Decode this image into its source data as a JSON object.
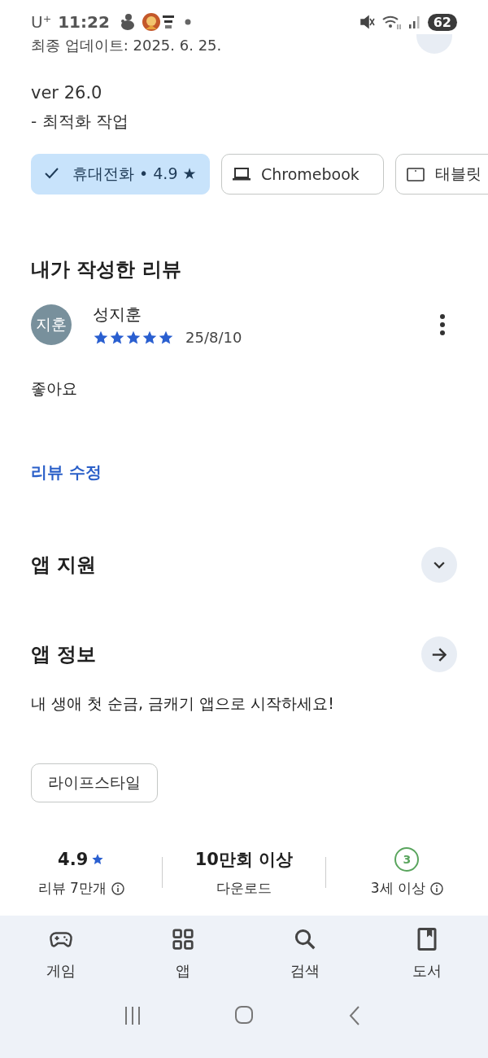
{
  "status_bar": {
    "carrier": "U⁺",
    "time": "11:22",
    "battery": "62"
  },
  "last_updated": "최종 업데이트: 2025. 6. 25.",
  "whats_new": {
    "version": "ver 26.0",
    "note": "- 최적화 작업"
  },
  "device_chips": [
    {
      "label": "휴대전화 • 4.9 ★",
      "kind": "phone",
      "selected": true
    },
    {
      "label": "Chromebook",
      "kind": "laptop",
      "selected": false
    },
    {
      "label": "태블릿",
      "kind": "tablet",
      "selected": false
    }
  ],
  "my_review": {
    "heading": "내가 작성한 리뷰",
    "avatar": "지훈",
    "author": "성지훈",
    "stars": 5,
    "date": "25/8/10",
    "text": "좋아요",
    "edit_link": "리뷰 수정"
  },
  "sections": [
    {
      "title": "앱 지원",
      "kind": "expand"
    },
    {
      "title": "앱 정보",
      "kind": "open"
    }
  ],
  "description": "내 생애 첫 순금, 금캐기 앱으로 시작하세요!",
  "category_chip": "라이프스타일",
  "stats": [
    {
      "kind": "rating",
      "value": "4.9",
      "label": "리뷰 7만개"
    },
    {
      "kind": "downloads",
      "value": "10만회 이상",
      "label": "다운로드"
    },
    {
      "kind": "age",
      "value": "3",
      "label": "3세 이상"
    }
  ],
  "bottom_nav": [
    {
      "label": "게임",
      "kind": "games",
      "selected": false
    },
    {
      "label": "앱",
      "kind": "apps",
      "selected": false
    },
    {
      "label": "검색",
      "kind": "search",
      "selected": false
    },
    {
      "label": "도서",
      "kind": "books",
      "selected": false
    }
  ]
}
